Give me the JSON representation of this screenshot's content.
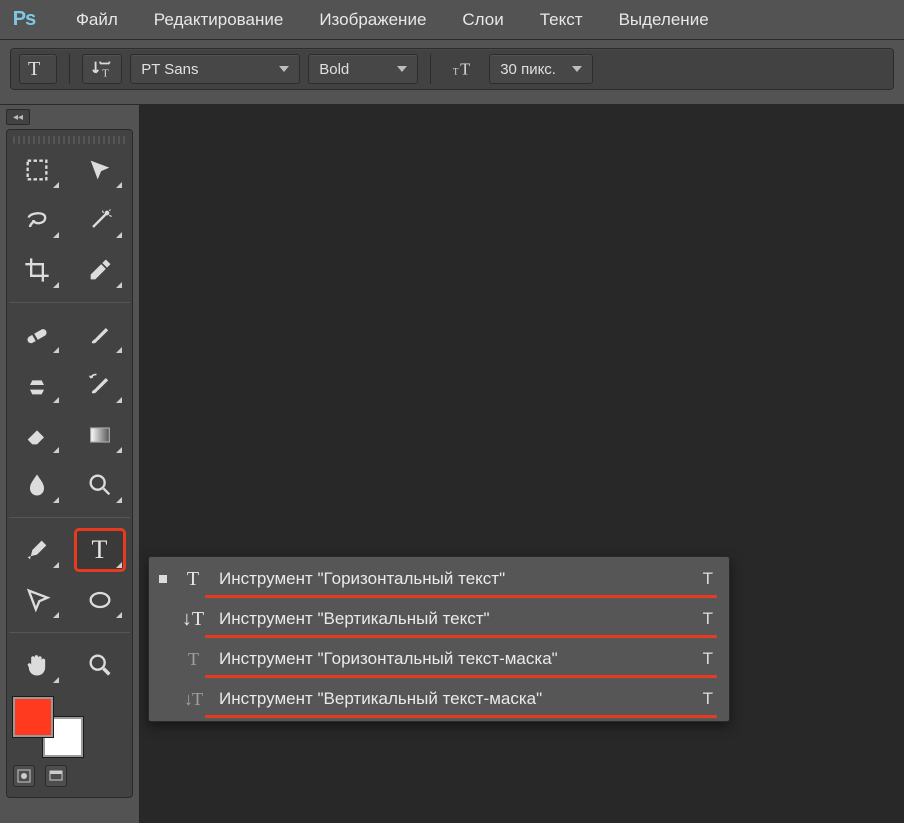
{
  "app": {
    "logo_text": "Ps"
  },
  "menu": {
    "items": [
      "Файл",
      "Редактирование",
      "Изображение",
      "Слои",
      "Текст",
      "Выделение"
    ]
  },
  "options": {
    "tool_glyph": "T",
    "orientation_icon": "orientation-toggle",
    "font_family": "PT Sans",
    "font_weight": "Bold",
    "font_size": "30 пикс.",
    "size_icon": "text-size"
  },
  "tools": [
    {
      "name": "marquee",
      "fly": true
    },
    {
      "name": "move",
      "fly": true
    },
    {
      "name": "lasso",
      "fly": true
    },
    {
      "name": "magic-wand",
      "fly": true
    },
    {
      "name": "crop",
      "fly": true
    },
    {
      "name": "eyedropper",
      "fly": true
    },
    {
      "name": "healing-brush",
      "fly": true
    },
    {
      "name": "brush",
      "fly": true
    },
    {
      "name": "clone-stamp",
      "fly": true
    },
    {
      "name": "history-brush",
      "fly": true
    },
    {
      "name": "eraser",
      "fly": true
    },
    {
      "name": "gradient",
      "fly": true
    },
    {
      "name": "blur",
      "fly": true
    },
    {
      "name": "dodge",
      "fly": true
    },
    {
      "name": "pen",
      "fly": true
    },
    {
      "name": "type",
      "fly": true,
      "highlight": true,
      "glyph": "T"
    },
    {
      "name": "path-select",
      "fly": true
    },
    {
      "name": "ellipse-shape",
      "fly": true
    },
    {
      "name": "hand",
      "fly": true
    },
    {
      "name": "zoom",
      "fly": false
    }
  ],
  "colors": {
    "foreground": "#ff3a1f",
    "background": "#ffffff"
  },
  "flyout": {
    "items": [
      {
        "selected": true,
        "icon": "horizontal-type",
        "label": "Инструмент \"Горизонтальный текст\"",
        "shortcut": "T"
      },
      {
        "selected": false,
        "icon": "vertical-type",
        "label": "Инструмент \"Вертикальный текст\"",
        "shortcut": "T"
      },
      {
        "selected": false,
        "icon": "horizontal-type-mask",
        "label": "Инструмент \"Горизонтальный текст-маска\"",
        "shortcut": "T"
      },
      {
        "selected": false,
        "icon": "vertical-type-mask",
        "label": "Инструмент \"Вертикальный текст-маска\"",
        "shortcut": "T"
      }
    ]
  }
}
